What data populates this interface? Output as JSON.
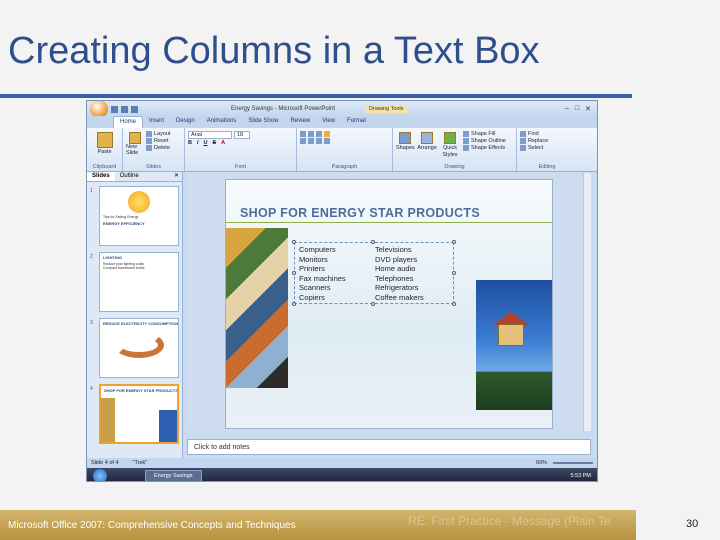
{
  "slide_title": "Creating Columns in a Text Box",
  "window": {
    "title": "Energy Savings - Microsoft PowerPoint",
    "contextual": "Drawing Tools"
  },
  "tabs": [
    "Home",
    "Insert",
    "Design",
    "Animations",
    "Slide Show",
    "Review",
    "View",
    "Format"
  ],
  "ribbon": {
    "clipboard": {
      "label": "Clipboard",
      "paste": "Paste"
    },
    "slides": {
      "label": "Slides",
      "new_slide": "New Slide",
      "layout": "Layout",
      "reset": "Reset",
      "delete": "Delete"
    },
    "font": {
      "label": "Font",
      "name": "Arial",
      "size": "18"
    },
    "paragraph": {
      "label": "Paragraph"
    },
    "drawing": {
      "label": "Drawing",
      "shapes": "Shapes",
      "arrange": "Arrange",
      "quick_styles": "Quick Styles",
      "shape_fill": "Shape Fill",
      "shape_outline": "Shape Outline",
      "shape_effects": "Shape Effects"
    },
    "editing": {
      "label": "Editing",
      "find": "Find",
      "replace": "Replace",
      "select": "Select"
    }
  },
  "panel": {
    "tabs": [
      "Slides",
      "Outline"
    ],
    "thumbs": [
      {
        "num": "1",
        "title": "ENERGY EFFICIENCY",
        "subtitle": "Tips for Saving Energy"
      },
      {
        "num": "2",
        "title": "LIGHTING",
        "lines": [
          "Reduce your lighting costs",
          "Compact fluorescent bulbs"
        ]
      },
      {
        "num": "3",
        "title": "REDUCE ELECTRICITY CONSUMPTION"
      },
      {
        "num": "4",
        "title": "SHOP FOR ENERGY STAR PRODUCTS"
      }
    ]
  },
  "slide": {
    "heading": "SHOP FOR ENERGY STAR PRODUCTS",
    "col1": [
      "Computers",
      "Monitors",
      "Printers",
      "Fax machines",
      "Scanners",
      "Copiers"
    ],
    "col2": [
      "Televisions",
      "DVD players",
      "Home audio",
      "Telephones",
      "Refrigerators",
      "Coffee makers"
    ]
  },
  "notes_placeholder": "Click to add notes",
  "status": {
    "slide": "Slide 4 of 4",
    "theme": "\"Trek\"",
    "zoom": "69%"
  },
  "taskbar": {
    "app": "Energy Savings",
    "clock": "5:53 PM"
  },
  "footer": {
    "text": "Microsoft Office 2007: Comprehensive Concepts and Techniques",
    "ghost": "RE: First Practice - Message (Plain Te",
    "page": "30"
  }
}
